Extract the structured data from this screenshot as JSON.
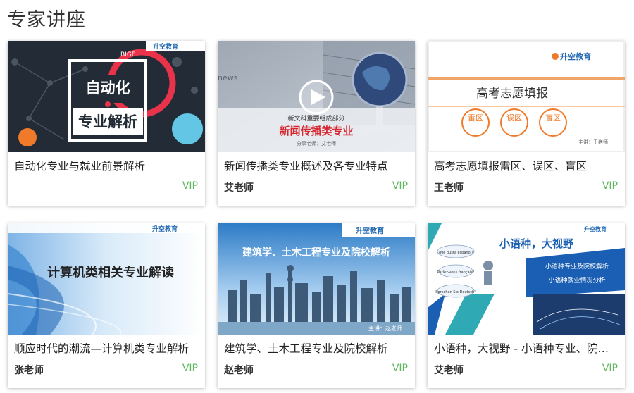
{
  "section": {
    "title": "专家讲座"
  },
  "cards": [
    {
      "title": "自动化专业与就业前景解析",
      "teacher": "",
      "badge": "VIP",
      "thumb": {
        "brand": "升空教育",
        "tag": "BIGE",
        "line1": "自动化",
        "line2": "专业解析"
      }
    },
    {
      "title": "新闻传播类专业概述及各专业特点",
      "teacher": "艾老师",
      "badge": "VIP",
      "thumb": {
        "word": "news",
        "sub": "新文科重要组成部分",
        "main": "新闻传播类专业",
        "foot": "分享老师：艾老师"
      }
    },
    {
      "title": "高考志愿填报雷区、误区、盲区",
      "teacher": "王老师",
      "badge": "VIP",
      "thumb": {
        "brand": "升空教育",
        "heading": "高考志愿填报",
        "c1": "雷区",
        "c2": "误区",
        "c3": "盲区",
        "foot": "主讲：王老师"
      }
    },
    {
      "title": "顺应时代的潮流—计算机类专业解析",
      "teacher": "张老师",
      "badge": "VIP",
      "thumb": {
        "brand": "升空教育",
        "main": "计算机类相关专业解读"
      }
    },
    {
      "title": "建筑学、土木工程专业及院校解析",
      "teacher": "赵老师",
      "badge": "VIP",
      "thumb": {
        "brand": "升空教育",
        "main": "建筑学、土木工程专业及院校解析",
        "foot": "主讲：赵老师"
      }
    },
    {
      "title": "小语种，大视野 - 小语种专业、院校解析",
      "teacher": "艾老师",
      "badge": "VIP",
      "thumb": {
        "brand": "升空教育",
        "main": "小语种，大视野",
        "b1": "小语种专业及院校解析",
        "b2": "小语种就业情况分析",
        "bubbles": [
          "¿Me gusta español?",
          "Parlez-vous français?",
          "Sprechen Sie Deutsch?"
        ]
      }
    }
  ]
}
